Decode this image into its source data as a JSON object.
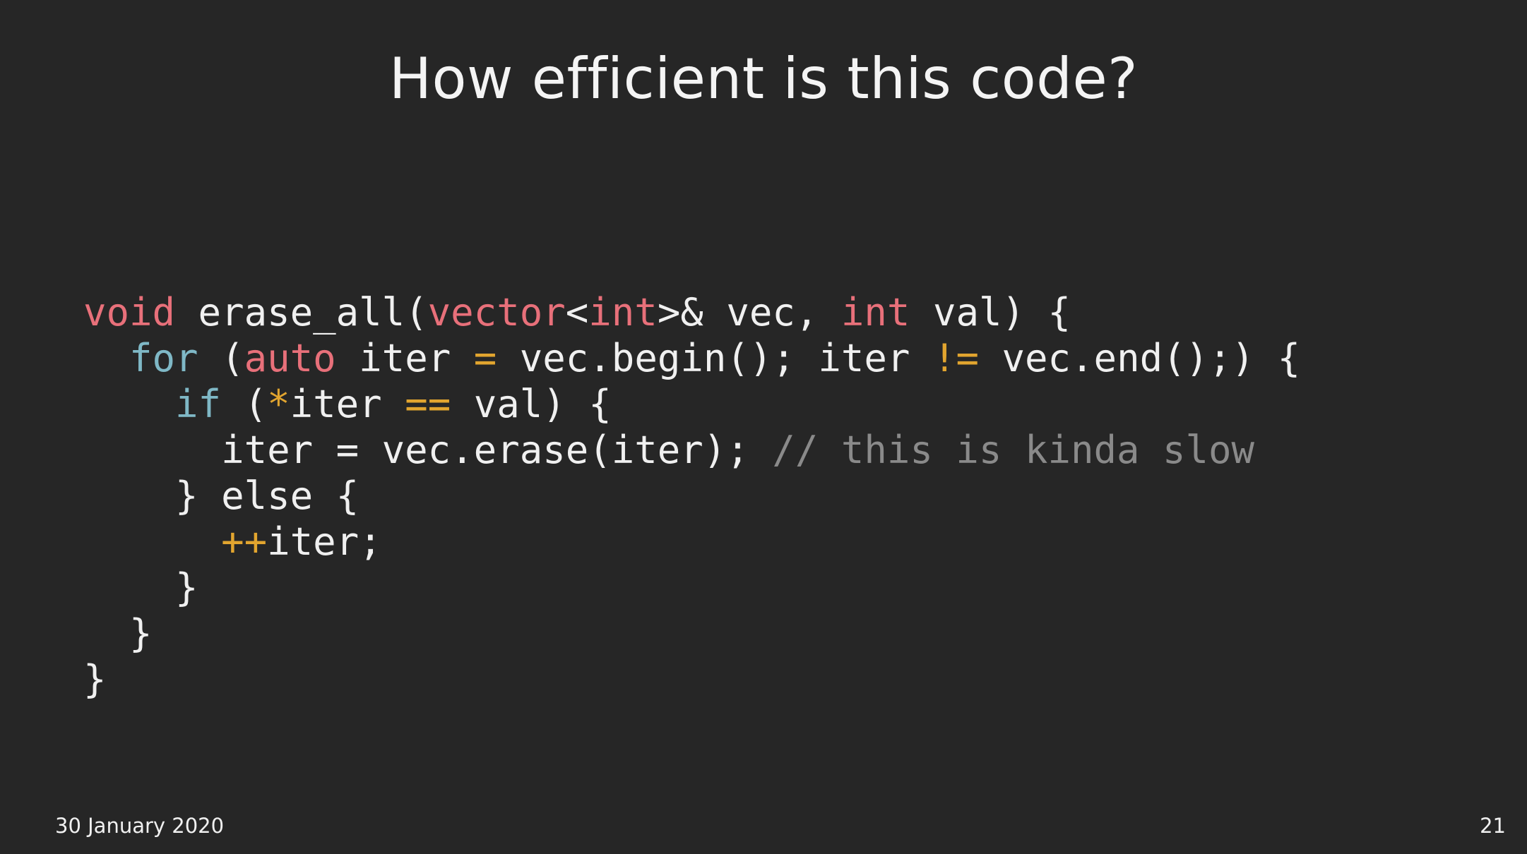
{
  "slide": {
    "title": "How efficient is this code?",
    "date": "30 January 2020",
    "page_number": "21"
  },
  "colors": {
    "background": "#262626",
    "text": "#f0f0f0",
    "type_keyword": "#e8707a",
    "control_keyword": "#7fb8c6",
    "operator": "#e2a52f",
    "comment": "#8a8a8a"
  },
  "code": {
    "lines": [
      [
        {
          "t": "void",
          "c": "type_keyword"
        },
        {
          "t": " erase_all(",
          "c": "text"
        },
        {
          "t": "vector",
          "c": "type_keyword"
        },
        {
          "t": "<",
          "c": "text"
        },
        {
          "t": "int",
          "c": "type_keyword"
        },
        {
          "t": ">& vec, ",
          "c": "text"
        },
        {
          "t": "int",
          "c": "type_keyword"
        },
        {
          "t": " val) {",
          "c": "text"
        }
      ],
      [
        {
          "t": "  ",
          "c": "text"
        },
        {
          "t": "for",
          "c": "control_keyword"
        },
        {
          "t": " (",
          "c": "text"
        },
        {
          "t": "auto",
          "c": "type_keyword"
        },
        {
          "t": " iter ",
          "c": "text"
        },
        {
          "t": "=",
          "c": "operator"
        },
        {
          "t": " vec.begin(); iter ",
          "c": "text"
        },
        {
          "t": "!=",
          "c": "operator"
        },
        {
          "t": " vec.end();) {",
          "c": "text"
        }
      ],
      [
        {
          "t": "    ",
          "c": "text"
        },
        {
          "t": "if",
          "c": "control_keyword"
        },
        {
          "t": " (",
          "c": "text"
        },
        {
          "t": "*",
          "c": "operator"
        },
        {
          "t": "iter ",
          "c": "text"
        },
        {
          "t": "==",
          "c": "operator"
        },
        {
          "t": " val) {",
          "c": "text"
        }
      ],
      [
        {
          "t": "      iter = vec.erase(iter); ",
          "c": "text"
        },
        {
          "t": "// this is kinda slow",
          "c": "comment"
        }
      ],
      [
        {
          "t": "    } else {",
          "c": "text"
        }
      ],
      [
        {
          "t": "      ",
          "c": "text"
        },
        {
          "t": "++",
          "c": "operator"
        },
        {
          "t": "iter;",
          "c": "text"
        }
      ],
      [
        {
          "t": "    }",
          "c": "text"
        }
      ],
      [
        {
          "t": "  }",
          "c": "text"
        }
      ],
      [
        {
          "t": "}",
          "c": "text"
        }
      ]
    ]
  }
}
